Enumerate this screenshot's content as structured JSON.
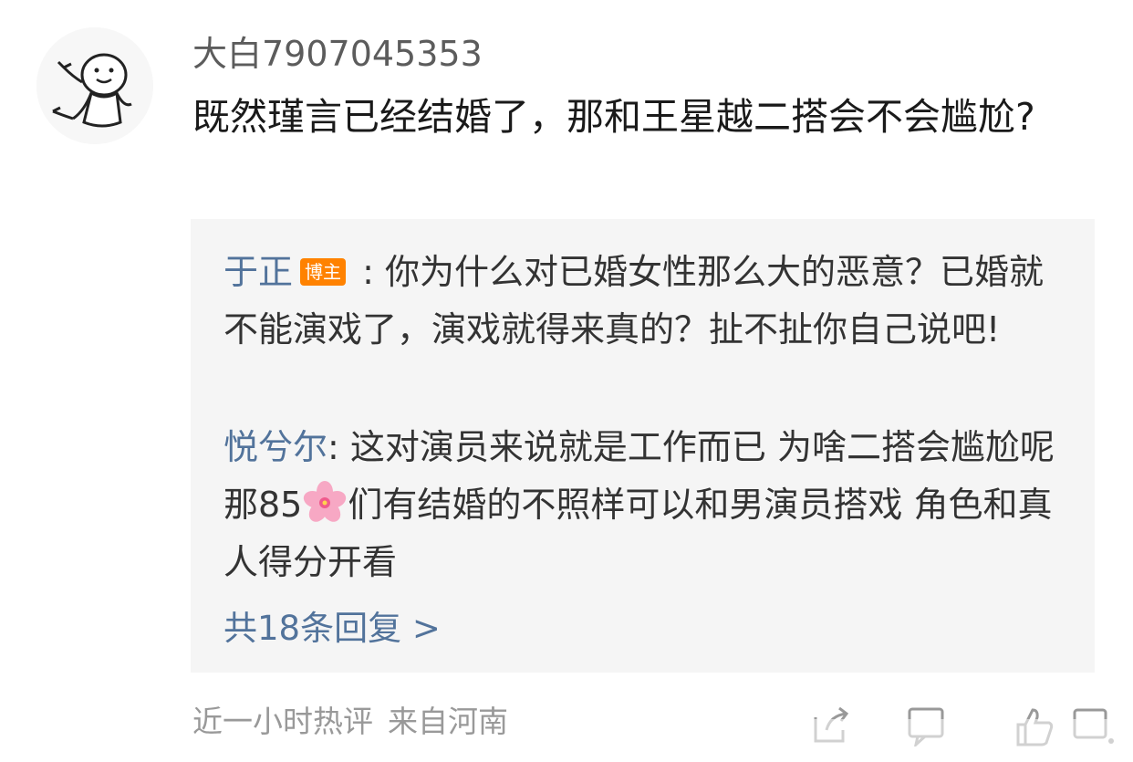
{
  "comment": {
    "username": "大白7907045353",
    "text": "既然瑾言已经结婚了，那和王星越二搭会不会尴尬?"
  },
  "replies": [
    {
      "author": "于正",
      "badge": "博主",
      "separator": " : ",
      "text": "你为什么对已婚女性那么大的恶意？已婚就不能演戏了，演戏就得来真的？扯不扯你自己说吧!"
    },
    {
      "author": "悦兮尔",
      "separator": ": ",
      "text_before_emoji": "这对演员来说就是工作而已 为啥二搭会尴尬呢 那85",
      "emoji": "cherry-blossom-emoji",
      "text_after_emoji": "们有结婚的不照样可以和男演员搭戏 角色和真人得分开看"
    }
  ],
  "more_replies": "共18条回复 >",
  "meta": {
    "time": "近一小时热评",
    "location": "来自河南"
  },
  "actions": [
    "share-icon",
    "comment-icon",
    "like-icon"
  ],
  "colors": {
    "link": "#52739b",
    "badge": "#ff8200",
    "reply_bg": "#f5f5f5",
    "meta": "#999999"
  }
}
